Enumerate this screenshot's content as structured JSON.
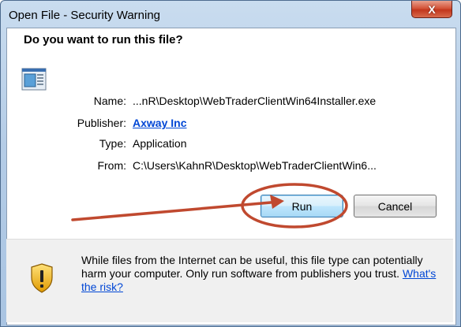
{
  "window": {
    "title": "Open File - Security Warning",
    "close_glyph": "X"
  },
  "dialog": {
    "question": "Do you want to run this file?",
    "file_icon": "application-file-icon",
    "fields": {
      "name_label": "Name:",
      "name_value": "...nR\\Desktop\\WebTraderClientWin64Installer.exe",
      "publisher_label": "Publisher:",
      "publisher_value": "Axway Inc",
      "type_label": "Type:",
      "type_value": "Application",
      "from_label": "From:",
      "from_value": "C:\\Users\\KahnR\\Desktop\\WebTraderClientWin6..."
    },
    "buttons": {
      "run": "Run",
      "cancel": "Cancel"
    }
  },
  "warning": {
    "icon": "shield-warning-icon",
    "text": "While files from the Internet can be useful, this file type can potentially harm your computer. Only run software from publishers you trust.",
    "link": "What's the risk?"
  },
  "colors": {
    "link": "#0046d5",
    "annotation": "#c0492f",
    "close_button": "#c2361c"
  }
}
